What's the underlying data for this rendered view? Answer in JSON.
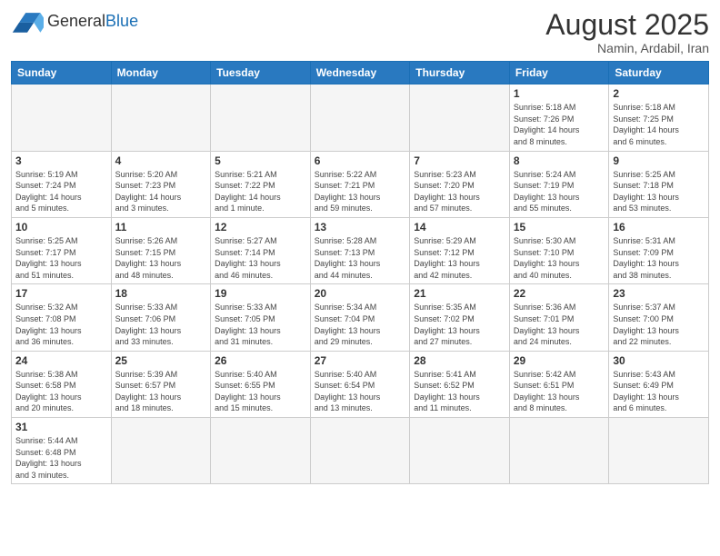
{
  "header": {
    "logo_general": "General",
    "logo_blue": "Blue",
    "month_year": "August 2025",
    "location": "Namin, Ardabil, Iran"
  },
  "weekdays": [
    "Sunday",
    "Monday",
    "Tuesday",
    "Wednesday",
    "Thursday",
    "Friday",
    "Saturday"
  ],
  "weeks": [
    [
      {
        "day": "",
        "info": ""
      },
      {
        "day": "",
        "info": ""
      },
      {
        "day": "",
        "info": ""
      },
      {
        "day": "",
        "info": ""
      },
      {
        "day": "",
        "info": ""
      },
      {
        "day": "1",
        "info": "Sunrise: 5:18 AM\nSunset: 7:26 PM\nDaylight: 14 hours\nand 8 minutes."
      },
      {
        "day": "2",
        "info": "Sunrise: 5:18 AM\nSunset: 7:25 PM\nDaylight: 14 hours\nand 6 minutes."
      }
    ],
    [
      {
        "day": "3",
        "info": "Sunrise: 5:19 AM\nSunset: 7:24 PM\nDaylight: 14 hours\nand 5 minutes."
      },
      {
        "day": "4",
        "info": "Sunrise: 5:20 AM\nSunset: 7:23 PM\nDaylight: 14 hours\nand 3 minutes."
      },
      {
        "day": "5",
        "info": "Sunrise: 5:21 AM\nSunset: 7:22 PM\nDaylight: 14 hours\nand 1 minute."
      },
      {
        "day": "6",
        "info": "Sunrise: 5:22 AM\nSunset: 7:21 PM\nDaylight: 13 hours\nand 59 minutes."
      },
      {
        "day": "7",
        "info": "Sunrise: 5:23 AM\nSunset: 7:20 PM\nDaylight: 13 hours\nand 57 minutes."
      },
      {
        "day": "8",
        "info": "Sunrise: 5:24 AM\nSunset: 7:19 PM\nDaylight: 13 hours\nand 55 minutes."
      },
      {
        "day": "9",
        "info": "Sunrise: 5:25 AM\nSunset: 7:18 PM\nDaylight: 13 hours\nand 53 minutes."
      }
    ],
    [
      {
        "day": "10",
        "info": "Sunrise: 5:25 AM\nSunset: 7:17 PM\nDaylight: 13 hours\nand 51 minutes."
      },
      {
        "day": "11",
        "info": "Sunrise: 5:26 AM\nSunset: 7:15 PM\nDaylight: 13 hours\nand 48 minutes."
      },
      {
        "day": "12",
        "info": "Sunrise: 5:27 AM\nSunset: 7:14 PM\nDaylight: 13 hours\nand 46 minutes."
      },
      {
        "day": "13",
        "info": "Sunrise: 5:28 AM\nSunset: 7:13 PM\nDaylight: 13 hours\nand 44 minutes."
      },
      {
        "day": "14",
        "info": "Sunrise: 5:29 AM\nSunset: 7:12 PM\nDaylight: 13 hours\nand 42 minutes."
      },
      {
        "day": "15",
        "info": "Sunrise: 5:30 AM\nSunset: 7:10 PM\nDaylight: 13 hours\nand 40 minutes."
      },
      {
        "day": "16",
        "info": "Sunrise: 5:31 AM\nSunset: 7:09 PM\nDaylight: 13 hours\nand 38 minutes."
      }
    ],
    [
      {
        "day": "17",
        "info": "Sunrise: 5:32 AM\nSunset: 7:08 PM\nDaylight: 13 hours\nand 36 minutes."
      },
      {
        "day": "18",
        "info": "Sunrise: 5:33 AM\nSunset: 7:06 PM\nDaylight: 13 hours\nand 33 minutes."
      },
      {
        "day": "19",
        "info": "Sunrise: 5:33 AM\nSunset: 7:05 PM\nDaylight: 13 hours\nand 31 minutes."
      },
      {
        "day": "20",
        "info": "Sunrise: 5:34 AM\nSunset: 7:04 PM\nDaylight: 13 hours\nand 29 minutes."
      },
      {
        "day": "21",
        "info": "Sunrise: 5:35 AM\nSunset: 7:02 PM\nDaylight: 13 hours\nand 27 minutes."
      },
      {
        "day": "22",
        "info": "Sunrise: 5:36 AM\nSunset: 7:01 PM\nDaylight: 13 hours\nand 24 minutes."
      },
      {
        "day": "23",
        "info": "Sunrise: 5:37 AM\nSunset: 7:00 PM\nDaylight: 13 hours\nand 22 minutes."
      }
    ],
    [
      {
        "day": "24",
        "info": "Sunrise: 5:38 AM\nSunset: 6:58 PM\nDaylight: 13 hours\nand 20 minutes."
      },
      {
        "day": "25",
        "info": "Sunrise: 5:39 AM\nSunset: 6:57 PM\nDaylight: 13 hours\nand 18 minutes."
      },
      {
        "day": "26",
        "info": "Sunrise: 5:40 AM\nSunset: 6:55 PM\nDaylight: 13 hours\nand 15 minutes."
      },
      {
        "day": "27",
        "info": "Sunrise: 5:40 AM\nSunset: 6:54 PM\nDaylight: 13 hours\nand 13 minutes."
      },
      {
        "day": "28",
        "info": "Sunrise: 5:41 AM\nSunset: 6:52 PM\nDaylight: 13 hours\nand 11 minutes."
      },
      {
        "day": "29",
        "info": "Sunrise: 5:42 AM\nSunset: 6:51 PM\nDaylight: 13 hours\nand 8 minutes."
      },
      {
        "day": "30",
        "info": "Sunrise: 5:43 AM\nSunset: 6:49 PM\nDaylight: 13 hours\nand 6 minutes."
      }
    ],
    [
      {
        "day": "31",
        "info": "Sunrise: 5:44 AM\nSunset: 6:48 PM\nDaylight: 13 hours\nand 3 minutes."
      },
      {
        "day": "",
        "info": ""
      },
      {
        "day": "",
        "info": ""
      },
      {
        "day": "",
        "info": ""
      },
      {
        "day": "",
        "info": ""
      },
      {
        "day": "",
        "info": ""
      },
      {
        "day": "",
        "info": ""
      }
    ]
  ]
}
